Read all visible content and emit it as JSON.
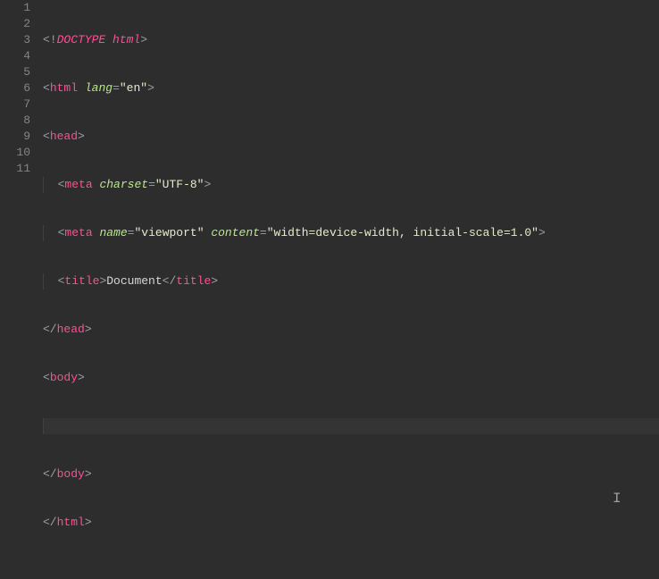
{
  "editor": {
    "totalLines": 11,
    "activeLine": 9,
    "lines": {
      "l1": [
        [
          "punct",
          "<!"
        ],
        [
          "doctype",
          "DOCTYPE"
        ],
        [
          "text",
          " "
        ],
        [
          "doctype",
          "html"
        ],
        [
          "punct",
          ">"
        ]
      ],
      "l2": [
        [
          "punct",
          "<"
        ],
        [
          "tag",
          "html"
        ],
        [
          "text",
          " "
        ],
        [
          "attr",
          "lang"
        ],
        [
          "punct",
          "="
        ],
        [
          "str",
          "\"en\""
        ],
        [
          "punct",
          ">"
        ]
      ],
      "l3": [
        [
          "punct",
          "<"
        ],
        [
          "tag",
          "head"
        ],
        [
          "punct",
          ">"
        ]
      ],
      "l4": [
        [
          "punct",
          "<"
        ],
        [
          "tag",
          "meta"
        ],
        [
          "text",
          " "
        ],
        [
          "attr",
          "charset"
        ],
        [
          "punct",
          "="
        ],
        [
          "str",
          "\"UTF-8\""
        ],
        [
          "punct",
          ">"
        ]
      ],
      "l5": [
        [
          "punct",
          "<"
        ],
        [
          "tag",
          "meta"
        ],
        [
          "text",
          " "
        ],
        [
          "attr",
          "name"
        ],
        [
          "punct",
          "="
        ],
        [
          "str",
          "\"viewport\""
        ],
        [
          "text",
          " "
        ],
        [
          "attr",
          "content"
        ],
        [
          "punct",
          "="
        ],
        [
          "str",
          "\"width=device-width, initial-scale=1.0\""
        ],
        [
          "punct",
          ">"
        ]
      ],
      "l6": [
        [
          "punct",
          "<"
        ],
        [
          "tag",
          "title"
        ],
        [
          "punct",
          ">"
        ],
        [
          "text",
          "Document"
        ],
        [
          "punct",
          "</"
        ],
        [
          "tag",
          "title"
        ],
        [
          "punct",
          ">"
        ]
      ],
      "l7": [
        [
          "punct",
          "</"
        ],
        [
          "tag",
          "head"
        ],
        [
          "punct",
          ">"
        ]
      ],
      "l8": [
        [
          "punct",
          "<"
        ],
        [
          "tag",
          "body"
        ],
        [
          "punct",
          ">"
        ]
      ],
      "l9": [],
      "l10": [
        [
          "punct",
          "</"
        ],
        [
          "tag",
          "body"
        ],
        [
          "punct",
          ">"
        ]
      ],
      "l11": [
        [
          "punct",
          "</"
        ],
        [
          "tag",
          "html"
        ],
        [
          "punct",
          ">"
        ]
      ]
    },
    "indent": {
      "l4": 1,
      "l5": 1,
      "l6": 1,
      "l9": 1
    }
  }
}
